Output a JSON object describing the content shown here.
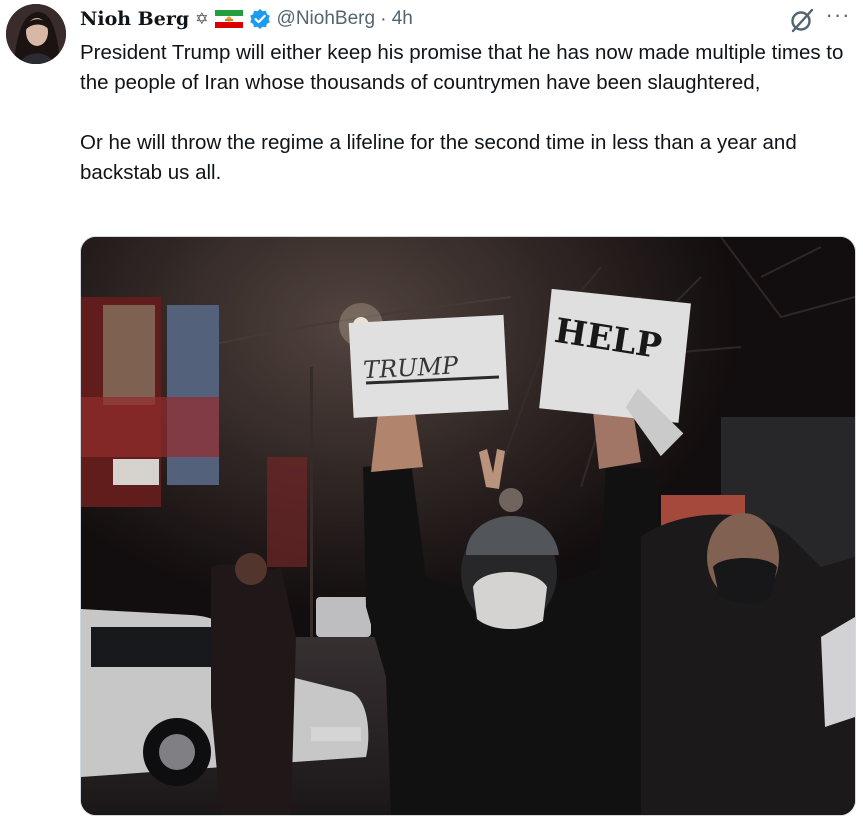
{
  "tweet": {
    "author_name": "Nioh Berg",
    "name_symbol": "✡",
    "handle": "@NiohBerg",
    "separator": "·",
    "time": "4h",
    "paragraphs": [
      "President Trump will either keep his promise that he has now made multiple times to the people of Iran whose thousands of countrymen have been slaughtered,",
      "Or he will throw the regime a lifeline for the second time in less than a year and backstab us all."
    ],
    "more_label": "···"
  },
  "media": {
    "sign_left": "TRUMP",
    "sign_right": "HELP"
  },
  "icons": {
    "verified": "verified-badge-icon",
    "flag": "iran-lion-sun-flag-icon",
    "grok": "grok-icon",
    "more": "more-icon"
  },
  "colors": {
    "verified_blue": "#1d9bf0",
    "secondary_text": "#536471"
  }
}
